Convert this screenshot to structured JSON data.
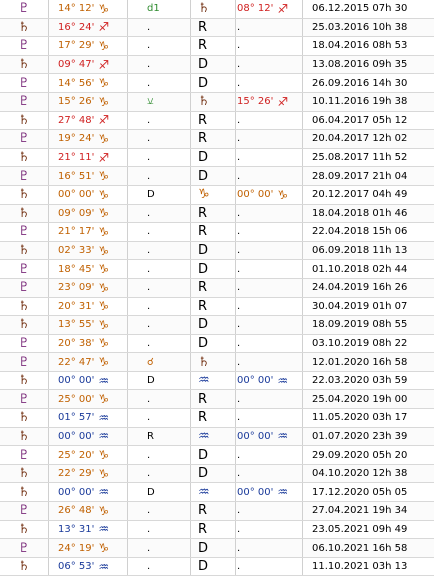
{
  "colors": {
    "saturn": "#7a3b1e",
    "jupiter": "#7a2a7a",
    "green": "#2e8b2e",
    "red": "#d02020",
    "orange": "#c06000",
    "blue": "#1a3a9a",
    "black": "#000000"
  },
  "rows": [
    {
      "planet": "♇",
      "pc": "jupiter",
      "pos": "14° 12'",
      "sign": "♑",
      "pos_c": "orange",
      "aspect": "d1",
      "ac": "green",
      "retro": "♄",
      "rc": "saturn",
      "pos2": "08° 12'",
      "sign2": "♐",
      "p2c": "red",
      "date": "06.12.2015 07h 30"
    },
    {
      "planet": "♄",
      "pc": "saturn",
      "pos": "16° 24'",
      "sign": "♐",
      "pos_c": "red",
      "aspect": ".",
      "ac": "black",
      "retro": "R",
      "rc": "black",
      "pos2": ".",
      "sign2": "",
      "p2c": "black",
      "date": "25.03.2016 10h 38"
    },
    {
      "planet": "♇",
      "pc": "jupiter",
      "pos": "17° 29'",
      "sign": "♑",
      "pos_c": "orange",
      "aspect": ".",
      "ac": "black",
      "retro": "R",
      "rc": "black",
      "pos2": ".",
      "sign2": "",
      "p2c": "black",
      "date": "18.04.2016 08h 53"
    },
    {
      "planet": "♄",
      "pc": "saturn",
      "pos": "09° 47'",
      "sign": "♐",
      "pos_c": "red",
      "aspect": ".",
      "ac": "black",
      "retro": "D",
      "rc": "black",
      "pos2": ".",
      "sign2": "",
      "p2c": "black",
      "date": "13.08.2016 09h 35"
    },
    {
      "planet": "♇",
      "pc": "jupiter",
      "pos": "14° 56'",
      "sign": "♑",
      "pos_c": "orange",
      "aspect": ".",
      "ac": "black",
      "retro": "D",
      "rc": "black",
      "pos2": ".",
      "sign2": "",
      "p2c": "black",
      "date": "26.09.2016 14h 30"
    },
    {
      "planet": "♇",
      "pc": "jupiter",
      "pos": "15° 26'",
      "sign": "♑",
      "pos_c": "orange",
      "aspect": "⚺",
      "ac": "green",
      "retro": "♄",
      "rc": "saturn",
      "pos2": "15° 26'",
      "sign2": "♐",
      "p2c": "red",
      "date": "10.11.2016 19h 38"
    },
    {
      "planet": "♄",
      "pc": "saturn",
      "pos": "27° 48'",
      "sign": "♐",
      "pos_c": "red",
      "aspect": ".",
      "ac": "black",
      "retro": "R",
      "rc": "black",
      "pos2": ".",
      "sign2": "",
      "p2c": "black",
      "date": "06.04.2017 05h 12"
    },
    {
      "planet": "♇",
      "pc": "jupiter",
      "pos": "19° 24'",
      "sign": "♑",
      "pos_c": "orange",
      "aspect": ".",
      "ac": "black",
      "retro": "R",
      "rc": "black",
      "pos2": ".",
      "sign2": "",
      "p2c": "black",
      "date": "20.04.2017 12h 02"
    },
    {
      "planet": "♄",
      "pc": "saturn",
      "pos": "21° 11'",
      "sign": "♐",
      "pos_c": "red",
      "aspect": ".",
      "ac": "black",
      "retro": "D",
      "rc": "black",
      "pos2": ".",
      "sign2": "",
      "p2c": "black",
      "date": "25.08.2017 11h 52"
    },
    {
      "planet": "♇",
      "pc": "jupiter",
      "pos": "16° 51'",
      "sign": "♑",
      "pos_c": "orange",
      "aspect": ".",
      "ac": "black",
      "retro": "D",
      "rc": "black",
      "pos2": ".",
      "sign2": "",
      "p2c": "black",
      "date": "28.09.2017 21h 04"
    },
    {
      "planet": "♄",
      "pc": "saturn",
      "pos": "00° 00'",
      "sign": "♑",
      "pos_c": "orange",
      "aspect": "D",
      "ac": "black",
      "retro": "♑",
      "rc": "orange",
      "pos2": "00° 00'",
      "sign2": "♑",
      "p2c": "orange",
      "date": "20.12.2017 04h 49"
    },
    {
      "planet": "♄",
      "pc": "saturn",
      "pos": "09° 09'",
      "sign": "♑",
      "pos_c": "orange",
      "aspect": ".",
      "ac": "black",
      "retro": "R",
      "rc": "black",
      "pos2": ".",
      "sign2": "",
      "p2c": "black",
      "date": "18.04.2018 01h 46"
    },
    {
      "planet": "♇",
      "pc": "jupiter",
      "pos": "21° 17'",
      "sign": "♑",
      "pos_c": "orange",
      "aspect": ".",
      "ac": "black",
      "retro": "R",
      "rc": "black",
      "pos2": ".",
      "sign2": "",
      "p2c": "black",
      "date": "22.04.2018 15h 06"
    },
    {
      "planet": "♄",
      "pc": "saturn",
      "pos": "02° 33'",
      "sign": "♑",
      "pos_c": "orange",
      "aspect": ".",
      "ac": "black",
      "retro": "D",
      "rc": "black",
      "pos2": ".",
      "sign2": "",
      "p2c": "black",
      "date": "06.09.2018 11h 13"
    },
    {
      "planet": "♇",
      "pc": "jupiter",
      "pos": "18° 45'",
      "sign": "♑",
      "pos_c": "orange",
      "aspect": ".",
      "ac": "black",
      "retro": "D",
      "rc": "black",
      "pos2": ".",
      "sign2": "",
      "p2c": "black",
      "date": "01.10.2018 02h 44"
    },
    {
      "planet": "♇",
      "pc": "jupiter",
      "pos": "23° 09'",
      "sign": "♑",
      "pos_c": "orange",
      "aspect": ".",
      "ac": "black",
      "retro": "R",
      "rc": "black",
      "pos2": ".",
      "sign2": "",
      "p2c": "black",
      "date": "24.04.2019 16h 26"
    },
    {
      "planet": "♄",
      "pc": "saturn",
      "pos": "20° 31'",
      "sign": "♑",
      "pos_c": "orange",
      "aspect": ".",
      "ac": "black",
      "retro": "R",
      "rc": "black",
      "pos2": ".",
      "sign2": "",
      "p2c": "black",
      "date": "30.04.2019 01h 07"
    },
    {
      "planet": "♄",
      "pc": "saturn",
      "pos": "13° 55'",
      "sign": "♑",
      "pos_c": "orange",
      "aspect": ".",
      "ac": "black",
      "retro": "D",
      "rc": "black",
      "pos2": ".",
      "sign2": "",
      "p2c": "black",
      "date": "18.09.2019 08h 55"
    },
    {
      "planet": "♇",
      "pc": "jupiter",
      "pos": "20° 38'",
      "sign": "♑",
      "pos_c": "orange",
      "aspect": ".",
      "ac": "black",
      "retro": "D",
      "rc": "black",
      "pos2": ".",
      "sign2": "",
      "p2c": "black",
      "date": "03.10.2019 08h 22"
    },
    {
      "planet": "♇",
      "pc": "jupiter",
      "pos": "22° 47'",
      "sign": "♑",
      "pos_c": "orange",
      "aspect": "☌",
      "ac": "orange",
      "retro": "♄",
      "rc": "saturn",
      "pos2": ".",
      "sign2": "",
      "p2c": "black",
      "date": "12.01.2020 16h 58"
    },
    {
      "planet": "♄",
      "pc": "saturn",
      "pos": "00° 00'",
      "sign": "♒",
      "pos_c": "blue",
      "aspect": "D",
      "ac": "black",
      "retro": "♒",
      "rc": "blue",
      "pos2": "00° 00'",
      "sign2": "♒",
      "p2c": "blue",
      "date": "22.03.2020 03h 59"
    },
    {
      "planet": "♇",
      "pc": "jupiter",
      "pos": "25° 00'",
      "sign": "♑",
      "pos_c": "orange",
      "aspect": ".",
      "ac": "black",
      "retro": "R",
      "rc": "black",
      "pos2": ".",
      "sign2": "",
      "p2c": "black",
      "date": "25.04.2020 19h 00"
    },
    {
      "planet": "♄",
      "pc": "saturn",
      "pos": "01° 57'",
      "sign": "♒",
      "pos_c": "blue",
      "aspect": ".",
      "ac": "black",
      "retro": "R",
      "rc": "black",
      "pos2": ".",
      "sign2": "",
      "p2c": "black",
      "date": "11.05.2020 03h 17"
    },
    {
      "planet": "♄",
      "pc": "saturn",
      "pos": "00° 00'",
      "sign": "♒",
      "pos_c": "blue",
      "aspect": "R",
      "ac": "black",
      "retro": "♒",
      "rc": "blue",
      "pos2": "00° 00'",
      "sign2": "♒",
      "p2c": "blue",
      "date": "01.07.2020 23h 39"
    },
    {
      "planet": "♇",
      "pc": "jupiter",
      "pos": "25° 20'",
      "sign": "♑",
      "pos_c": "orange",
      "aspect": ".",
      "ac": "black",
      "retro": "D",
      "rc": "black",
      "pos2": ".",
      "sign2": "",
      "p2c": "black",
      "date": "29.09.2020 05h 20"
    },
    {
      "planet": "♄",
      "pc": "saturn",
      "pos": "22° 29'",
      "sign": "♑",
      "pos_c": "orange",
      "aspect": ".",
      "ac": "black",
      "retro": "D",
      "rc": "black",
      "pos2": ".",
      "sign2": "",
      "p2c": "black",
      "date": "04.10.2020 12h 38"
    },
    {
      "planet": "♄",
      "pc": "saturn",
      "pos": "00° 00'",
      "sign": "♒",
      "pos_c": "blue",
      "aspect": "D",
      "ac": "black",
      "retro": "♒",
      "rc": "blue",
      "pos2": "00° 00'",
      "sign2": "♒",
      "p2c": "blue",
      "date": "17.12.2020 05h 05"
    },
    {
      "planet": "♇",
      "pc": "jupiter",
      "pos": "26° 48'",
      "sign": "♑",
      "pos_c": "orange",
      "aspect": ".",
      "ac": "black",
      "retro": "R",
      "rc": "black",
      "pos2": ".",
      "sign2": "",
      "p2c": "black",
      "date": "27.04.2021 19h 34"
    },
    {
      "planet": "♄",
      "pc": "saturn",
      "pos": "13° 31'",
      "sign": "♒",
      "pos_c": "blue",
      "aspect": ".",
      "ac": "black",
      "retro": "R",
      "rc": "black",
      "pos2": ".",
      "sign2": "",
      "p2c": "black",
      "date": "23.05.2021 09h 49"
    },
    {
      "planet": "♇",
      "pc": "jupiter",
      "pos": "24° 19'",
      "sign": "♑",
      "pos_c": "orange",
      "aspect": ".",
      "ac": "black",
      "retro": "D",
      "rc": "black",
      "pos2": ".",
      "sign2": "",
      "p2c": "black",
      "date": "06.10.2021 16h 58"
    },
    {
      "planet": "♄",
      "pc": "saturn",
      "pos": "06° 53'",
      "sign": "♒",
      "pos_c": "blue",
      "aspect": ".",
      "ac": "black",
      "retro": "D",
      "rc": "black",
      "pos2": ".",
      "sign2": "",
      "p2c": "black",
      "date": "11.10.2021 03h 13"
    }
  ]
}
